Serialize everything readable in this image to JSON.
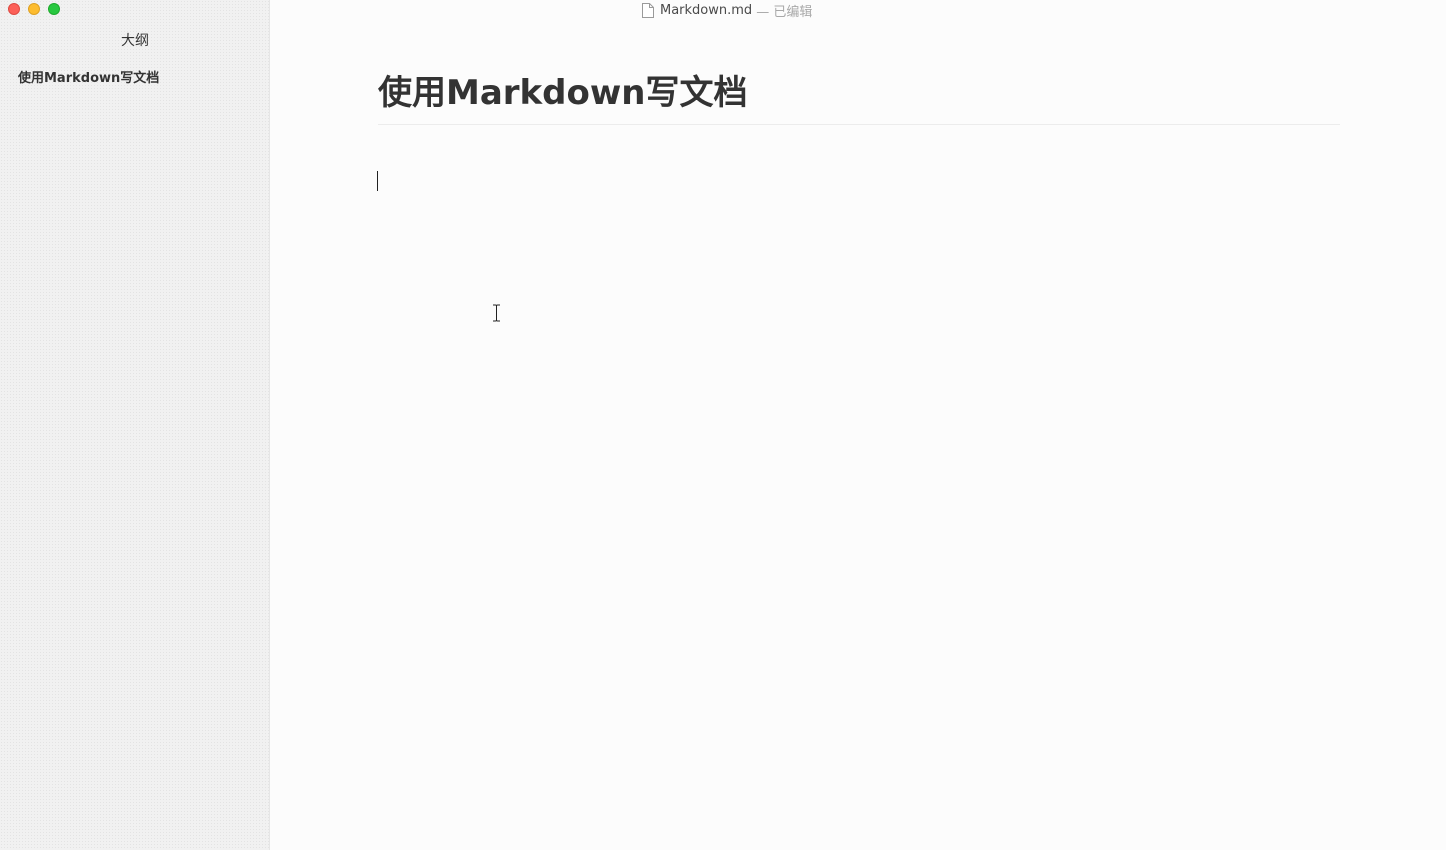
{
  "window": {
    "file_name": "Markdown.md",
    "status": "— 已编辑"
  },
  "sidebar": {
    "title": "大纲",
    "outline_items": [
      {
        "label": "使用Markdown写文档"
      }
    ]
  },
  "editor": {
    "heading": "使用Markdown写文档",
    "body": ""
  },
  "colors": {
    "close": "#fc5f57",
    "minimize": "#fdbc2e",
    "zoom": "#28c840",
    "text": "#333333"
  },
  "icons": [
    "file-icon",
    "text-cursor-icon"
  ]
}
